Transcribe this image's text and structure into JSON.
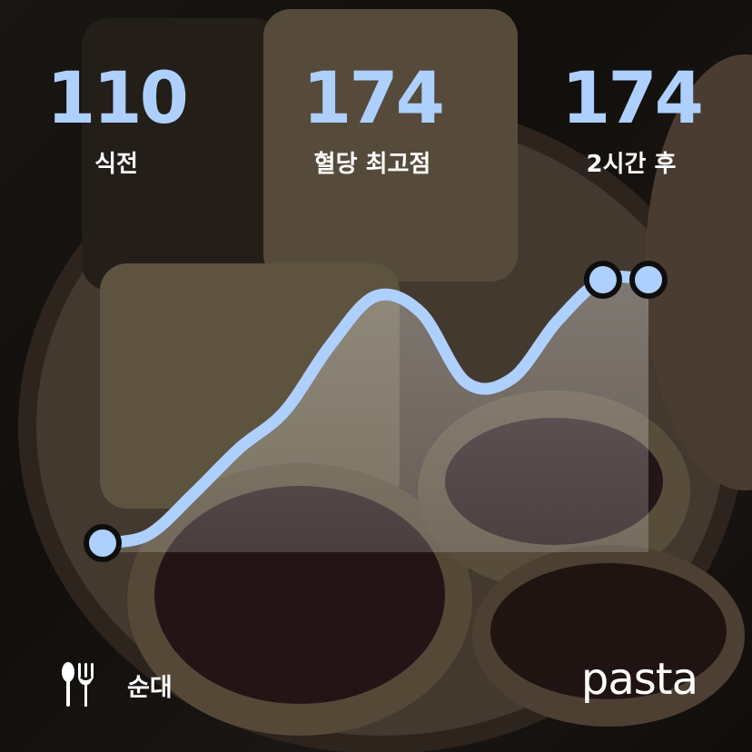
{
  "stats": {
    "before": {
      "value": "110",
      "label": "식전"
    },
    "peak": {
      "value": "174",
      "label": "혈당 최고점"
    },
    "after": {
      "value": "174",
      "label": "2시간 후"
    }
  },
  "food": {
    "name": "순대",
    "icon": "utensils-icon"
  },
  "brand": {
    "name": "pasta"
  },
  "colors": {
    "accent": "#aed0ff",
    "marker_outline": "#0e0e0e",
    "text": "#ffffff"
  },
  "chart_data": {
    "type": "line",
    "x": [
      0,
      1,
      2,
      3,
      4,
      5,
      6,
      7,
      8,
      9,
      10,
      11,
      12
    ],
    "values": [
      110,
      112,
      122,
      133,
      142,
      158,
      170,
      166,
      149,
      150,
      164,
      174,
      174
    ],
    "markers": [
      {
        "index": 0,
        "label": "식전"
      },
      {
        "index": 11,
        "label": "혈당 최고점"
      },
      {
        "index": 12,
        "label": "2시간 후"
      }
    ],
    "title": "",
    "xlabel": "",
    "ylabel": ""
  }
}
